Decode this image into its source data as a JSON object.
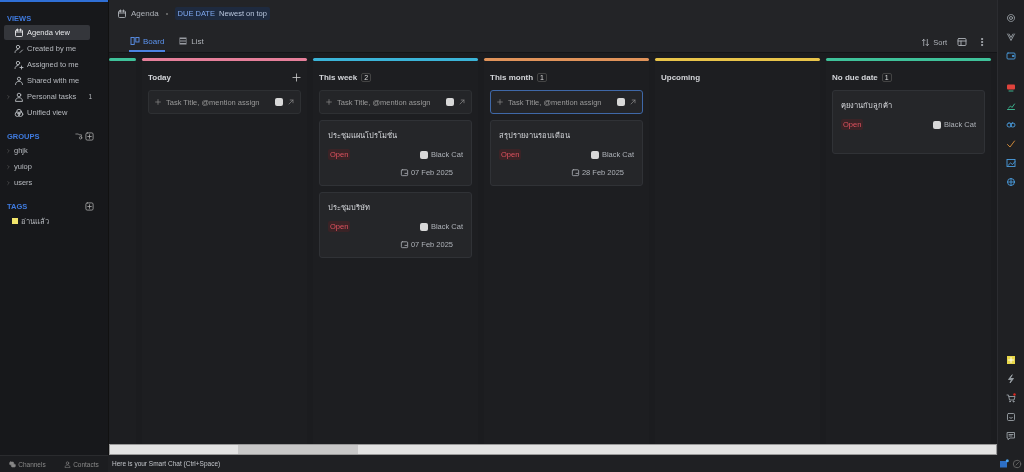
{
  "sidebar": {
    "views": {
      "title": "VIEWS",
      "items": [
        {
          "label": "Agenda view",
          "selected": true
        },
        {
          "label": "Created by me",
          "selected": false
        },
        {
          "label": "Assigned to me",
          "selected": false
        },
        {
          "label": "Shared with me",
          "selected": false
        },
        {
          "label": "Personal tasks",
          "selected": false,
          "expandable": true,
          "count": "1"
        },
        {
          "label": "Unified view",
          "selected": false
        }
      ]
    },
    "groups": {
      "title": "GROUPS",
      "items": [
        {
          "label": "ghjk"
        },
        {
          "label": "yuiop"
        },
        {
          "label": "users"
        }
      ]
    },
    "tags": {
      "title": "TAGS",
      "items": [
        {
          "label": "อ่านแล้ว",
          "color": "#f2e56b"
        }
      ]
    },
    "bottom_nav": [
      {
        "label": "Channels"
      },
      {
        "label": "Contacts"
      }
    ]
  },
  "header": {
    "title": "Agenda",
    "sort_badge": {
      "label": "DUE DATE",
      "value": "Newest on top"
    },
    "tabs": [
      {
        "label": "Board",
        "selected": true
      },
      {
        "label": "List",
        "selected": false
      }
    ],
    "sort_button": "Sort"
  },
  "board": {
    "columns": [
      {
        "color": "#3fc29a",
        "partial": true
      },
      {
        "title": "Today",
        "color": "#e57f9a",
        "add_button": true,
        "add_placeholder": "Task Title, @mention assign",
        "add_focused": false
      },
      {
        "title": "This week",
        "color": "#3bb4d8",
        "count": "2",
        "add_placeholder": "Task Title, @mention assign",
        "add_focused": false,
        "cards": [
          {
            "title": "ประชุมแผนโปรโมชั่น",
            "status": "Open",
            "assignee": "Black Cat",
            "due": "07 Feb 2025"
          },
          {
            "title": "ประชุมบริษัท",
            "status": "Open",
            "assignee": "Black Cat",
            "due": "07 Feb 2025"
          }
        ]
      },
      {
        "title": "This month",
        "color": "#e0935a",
        "count": "1",
        "add_placeholder": "Task Title, @mention assign",
        "add_focused": true,
        "cards": [
          {
            "title": "สรุปรายงานรอบเดือน",
            "status": "Open",
            "assignee": "Black Cat",
            "due": "28 Feb 2025"
          }
        ]
      },
      {
        "title": "Upcoming",
        "color": "#e8c44a"
      },
      {
        "title": "No due date",
        "color": "#3fc29a",
        "count": "1",
        "cards": [
          {
            "title": "คุยงานกับลูกค้า",
            "status": "Open",
            "assignee": "Black Cat"
          }
        ]
      }
    ]
  },
  "footer": {
    "smart_chat": "Here is your Smart Chat (Ctrl+Space)"
  }
}
